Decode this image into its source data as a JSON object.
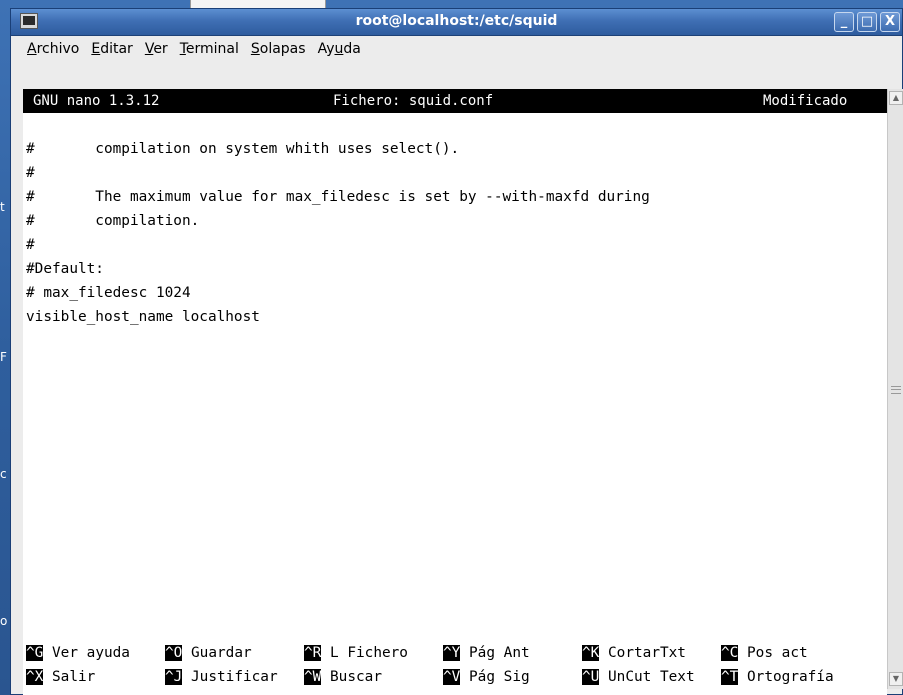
{
  "window": {
    "title": "root@localhost:/etc/squid",
    "buttons": {
      "minimize": "_",
      "maximize": "□",
      "close": "X"
    }
  },
  "menubar": {
    "items": [
      {
        "mnemonic": "A",
        "rest": "rchivo"
      },
      {
        "mnemonic": "E",
        "rest": "ditar"
      },
      {
        "mnemonic": "V",
        "rest": "er"
      },
      {
        "mnemonic": "T",
        "rest": "erminal"
      },
      {
        "mnemonic": "S",
        "rest": "olapas"
      },
      {
        "pre": "Ay",
        "mnemonic": "u",
        "rest": "da"
      }
    ]
  },
  "nano": {
    "version": "GNU nano 1.3.12",
    "file": "Fichero: squid.conf",
    "status": "Modificado"
  },
  "content": {
    "lines": [
      "",
      "#       compilation on system whith uses select().",
      "#",
      "#       The maximum value for max_filedesc is set by --with-maxfd during",
      "#       compilation.",
      "#",
      "#Default:",
      "# max_filedesc 1024",
      "visible_host_name localhost"
    ]
  },
  "shortcuts": {
    "row1": [
      {
        "key": "^G",
        "label": "Ver ayuda"
      },
      {
        "key": "^O",
        "label": "Guardar"
      },
      {
        "key": "^R",
        "label": "L Fichero"
      },
      {
        "key": "^Y",
        "label": "Pág Ant"
      },
      {
        "key": "^K",
        "label": "CortarTxt"
      },
      {
        "key": "^C",
        "label": "Pos act"
      }
    ],
    "row2": [
      {
        "key": "^X",
        "label": "Salir"
      },
      {
        "key": "^J",
        "label": "Justificar"
      },
      {
        "key": "^W",
        "label": "Buscar"
      },
      {
        "key": "^V",
        "label": "Pág Sig"
      },
      {
        "key": "^U",
        "label": "UnCut Text"
      },
      {
        "key": "^T",
        "label": "Ortografía"
      }
    ]
  },
  "desktop": {
    "side_letters": [
      "t",
      "F",
      "c",
      "o"
    ]
  },
  "colors": {
    "titlebar": "#3f6fb4",
    "nano_header_bg": "#000000",
    "terminal_bg": "#ffffff"
  }
}
